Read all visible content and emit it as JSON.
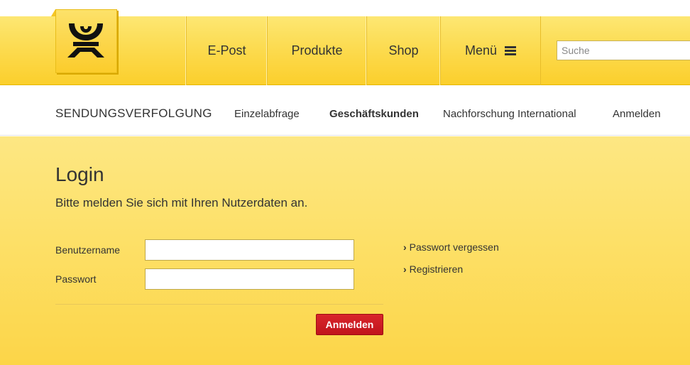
{
  "header": {
    "logo_icon": "posthorn-icon",
    "nav": [
      {
        "label": "E-Post"
      },
      {
        "label": "Produkte"
      },
      {
        "label": "Shop"
      },
      {
        "label": "Menü"
      }
    ],
    "menu_icon": "hamburger-icon",
    "search": {
      "placeholder": "Suche",
      "value": ""
    }
  },
  "subnav": {
    "title": "SENDUNGSVERFOLGUNG",
    "links": [
      {
        "label": "Einzelabfrage",
        "active": false
      },
      {
        "label": "Geschäftskunden",
        "active": true
      },
      {
        "label": "Nachforschung International",
        "active": false
      },
      {
        "label": "Anmelden",
        "active": false
      }
    ]
  },
  "login": {
    "title": "Login",
    "lead": "Bitte melden Sie sich mit Ihren Nutzerdaten an.",
    "username_label": "Benutzername",
    "username_value": "",
    "password_label": "Passwort",
    "password_value": "",
    "submit_label": "Anmelden",
    "links": [
      {
        "label": "Passwort vergessen"
      },
      {
        "label": "Registrieren"
      }
    ]
  },
  "colors": {
    "brand_yellow": "#fcd445",
    "button_red": "#c8161d",
    "text": "#333333"
  }
}
